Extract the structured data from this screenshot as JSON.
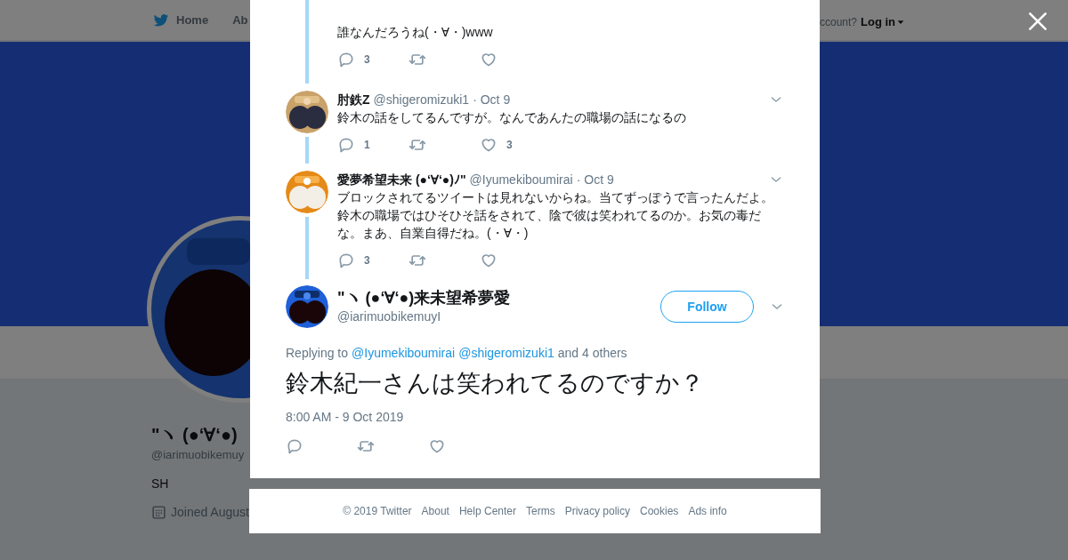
{
  "nav": {
    "items": [
      {
        "label": "Home"
      },
      {
        "label": "Ab"
      }
    ],
    "account_prompt": "ccount?",
    "login": "Log in"
  },
  "profile": {
    "name": "\"ヽ (●‘∀‘●)",
    "handle": "@iarimuobikemuy",
    "bio": "SH",
    "joined": "Joined August"
  },
  "thread": [
    {
      "kind": "continuation",
      "text": "誰なんだろうね(・∀・)www",
      "replies": "3"
    },
    {
      "kind": "tweet",
      "name": "肘鉄Z",
      "handle": "@shigeromizuki1",
      "date": "· Oct 9",
      "text": "鈴木の話をしてるんですが。なんであんたの職場の話になるの",
      "replies": "1",
      "likes": "3"
    },
    {
      "kind": "tweet",
      "name": "愛夢希望未来 (●‘∀‘●)ﾉ\"",
      "handle": "@Iyumekiboumirai",
      "date": "· Oct 9",
      "text": "ブロックされてるツイートは見れないからね。当てずっぽうで言ったんだよ。鈴木の職場ではひそひそ話をされて、陰で彼は笑われてるのか。お気の毒だな。まあ、自業自得だね。(・∀・)",
      "replies": "3"
    }
  ],
  "tweet": {
    "name": "\"ヽ (●‘∀‘●)来未望希夢愛",
    "handle": "@iarimuobikemuyI",
    "follow": "Follow",
    "replying_to": "Replying to",
    "mentions": [
      "@Iyumekiboumirai",
      "@shigeromizuki1"
    ],
    "others": "and 4 others",
    "text": "鈴木紀一さんは笑われてるのですか？",
    "timestamp": "8:00 AM - 9 Oct 2019"
  },
  "footer": [
    "© 2019 Twitter",
    "About",
    "Help Center",
    "Terms",
    "Privacy policy",
    "Cookies",
    "Ads info"
  ]
}
